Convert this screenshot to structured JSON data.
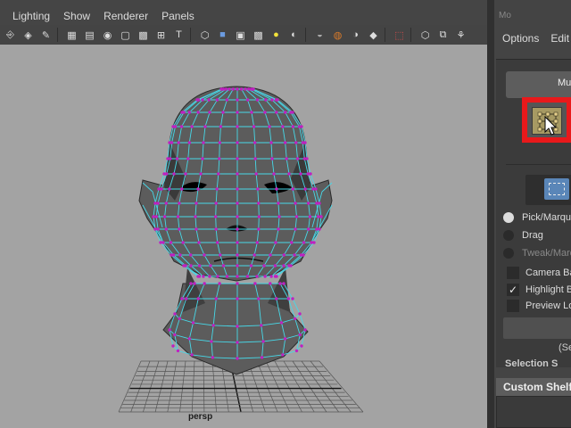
{
  "viewport": {
    "menu": [
      "Lighting",
      "Show",
      "Renderer",
      "Panels"
    ],
    "camera_label": "persp",
    "toolbar_icons": [
      "camera-icon",
      "bookmark-icon",
      "paint-icon",
      "separator",
      "grid-icon",
      "film-gate-icon",
      "resolution-gate-icon",
      "safe-area-icon",
      "field-chart-icon",
      "isolate-icon",
      "text-icon",
      "separator",
      "wireframe-icon",
      "smooth-shade-icon",
      "wireframe-on-shaded-icon",
      "textured-icon",
      "use-lights-icon",
      "shadows-icon",
      "separator",
      "screen-space-ao-icon",
      "motion-blur-icon",
      "multisample-aa-icon",
      "depth-of-field-icon",
      "separator",
      "isolate-select-icon",
      "separator",
      "xray-icon",
      "xray-joints-icon",
      "xray-components-icon"
    ]
  },
  "tool_settings": {
    "title": "Mo",
    "menu": [
      "Options",
      "Edit"
    ],
    "mu_button": "Mu",
    "pick_modes": [
      {
        "label": "Pick/Marque",
        "selected": true,
        "enabled": true
      },
      {
        "label": "Drag",
        "selected": false,
        "enabled": true
      },
      {
        "label": "Tweak/Marq",
        "selected": false,
        "enabled": false
      }
    ],
    "checkboxes": [
      {
        "label": "Camera Ba",
        "checked": false
      },
      {
        "label": "Highlight B",
        "checked": true
      },
      {
        "label": "Preview Lo",
        "checked": false
      }
    ],
    "sel_label": "(Se",
    "section_cut": "Selection S",
    "custom_shelf": "Custom Shelf"
  },
  "colors": {
    "viewport_bg": "#a3a3a3",
    "mesh_fill": "#5c5c5c",
    "wire": "#47d8e8",
    "vertex": "#c020c0",
    "highlight": "#e8191b"
  }
}
